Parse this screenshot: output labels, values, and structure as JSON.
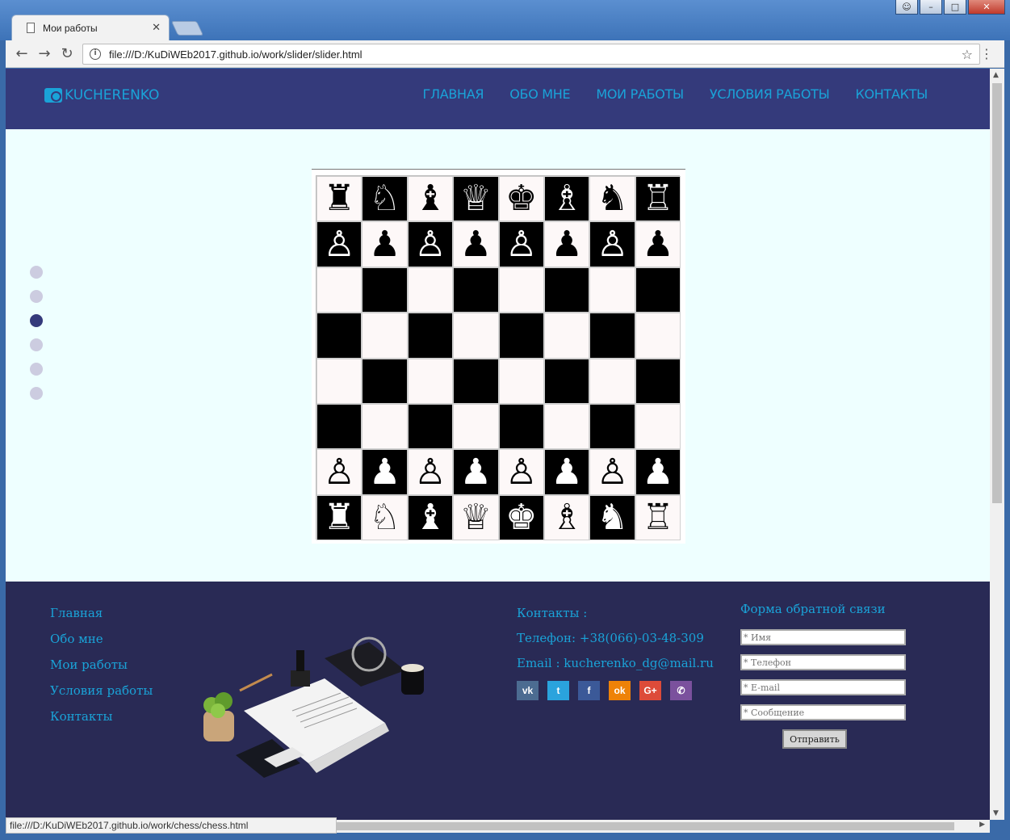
{
  "browser": {
    "tab_title": "Мои работы",
    "url": "file:///D:/KuDiWEb2017.github.io/work/slider/slider.html",
    "status_url": "file:///D:/KuDiWEb2017.github.io/work/chess/chess.html"
  },
  "header": {
    "logo": "KUCHERENKO",
    "nav": [
      "ГЛАВНАЯ",
      "ОБО МНЕ",
      "МОИ РАБОТЫ",
      "УСЛОВИЯ РАБОТЫ",
      "КОНТАКТЫ"
    ]
  },
  "slider": {
    "dot_count": 6,
    "active_dot": 3
  },
  "chess": {
    "rows": [
      [
        "♜",
        "♘",
        "♝",
        "♕",
        "♚",
        "♗",
        "♞",
        "♖"
      ],
      [
        "♙",
        "♟",
        "♙",
        "♟",
        "♙",
        "♟",
        "♙",
        "♟"
      ],
      [
        "",
        "",
        "",
        "",
        "",
        "",
        "",
        ""
      ],
      [
        "",
        "",
        "",
        "",
        "",
        "",
        "",
        ""
      ],
      [
        "",
        "",
        "",
        "",
        "",
        "",
        "",
        ""
      ],
      [
        "",
        "",
        "",
        "",
        "",
        "",
        "",
        ""
      ],
      [
        "♙",
        "♟",
        "♙",
        "♟",
        "♙",
        "♟",
        "♙",
        "♟"
      ],
      [
        "♜",
        "♘",
        "♝",
        "♕",
        "♚",
        "♗",
        "♞",
        "♖"
      ]
    ]
  },
  "footer": {
    "nav": [
      "Главная",
      "Обо мне",
      "Мои работы",
      "Условия работы",
      "Контакты"
    ],
    "contacts_title": "Контакты :",
    "phone": "Телефон: +38(066)-03-48-309",
    "email": "Email : kucherenko_dg@mail.ru",
    "socials": [
      {
        "name": "vk",
        "label": "vk",
        "color": "#4c6c91"
      },
      {
        "name": "twitter",
        "label": "t",
        "color": "#2aa3dd"
      },
      {
        "name": "facebook",
        "label": "f",
        "color": "#3b5998"
      },
      {
        "name": "odnoklassniki",
        "label": "ok",
        "color": "#ee8208"
      },
      {
        "name": "google-plus",
        "label": "G+",
        "color": "#dd4b39"
      },
      {
        "name": "viber",
        "label": "✆",
        "color": "#7b519d"
      }
    ],
    "form": {
      "title": "Форма обратной связи",
      "name_placeholder": "* Имя",
      "phone_placeholder": "* Телефон",
      "email_placeholder": "* E-mail",
      "message_placeholder": "* Сообщение",
      "submit": "Отправить"
    }
  }
}
